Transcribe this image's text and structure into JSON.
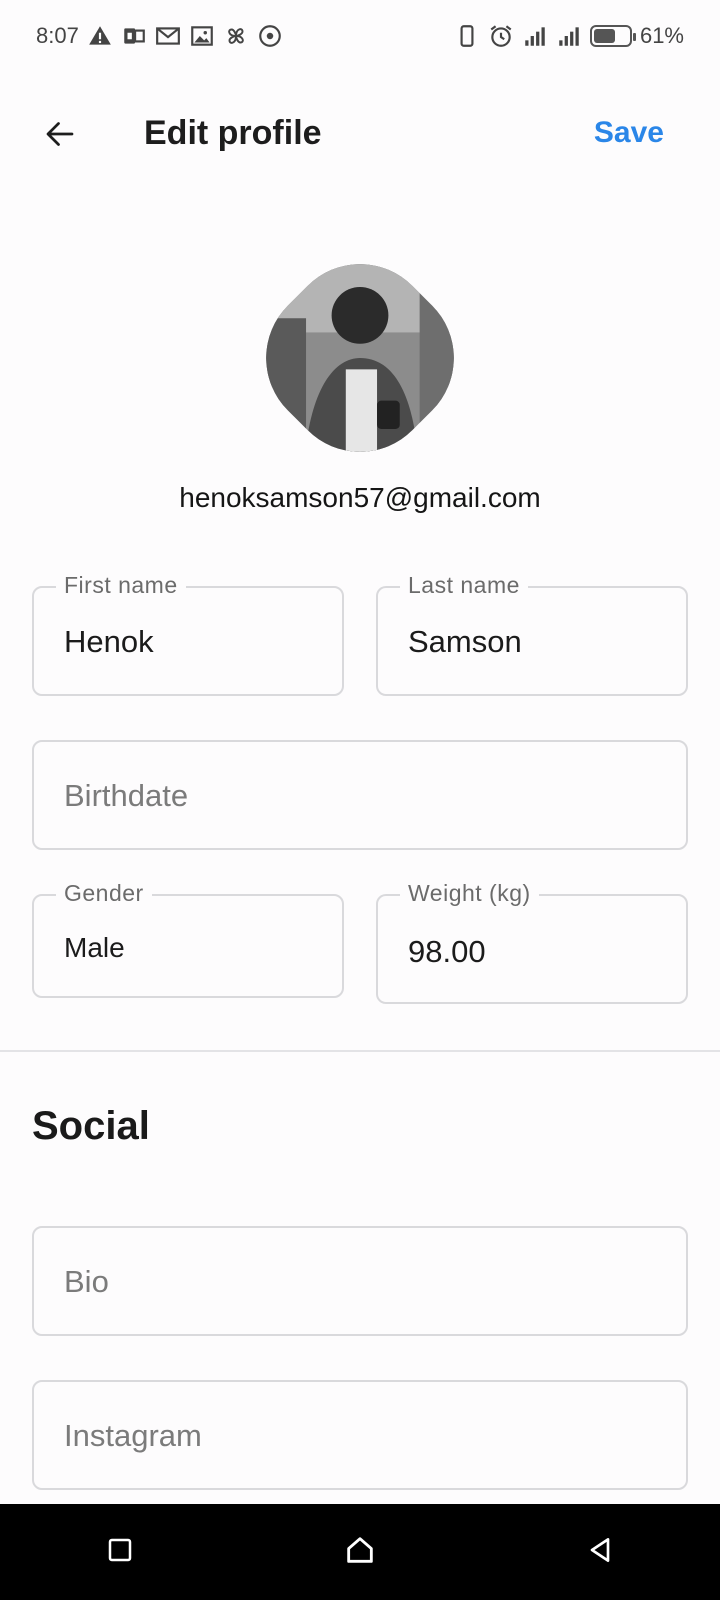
{
  "status_bar": {
    "time": "8:07",
    "battery_percent": "61%",
    "battery_level": 0.61,
    "left_icons": [
      "warning-icon",
      "outlook-icon",
      "gmail-icon",
      "gallery-icon",
      "pinwheel-icon",
      "circle-dot-icon"
    ],
    "right_icons": [
      "phone-outline-icon",
      "alarm-icon",
      "signal-icon",
      "signal-icon",
      "battery-icon"
    ]
  },
  "app_bar": {
    "title": "Edit profile",
    "save_label": "Save",
    "back_icon": "back-arrow-icon",
    "accent_color": "#2a86e8"
  },
  "profile": {
    "email": "henoksamson57@gmail.com"
  },
  "form": {
    "first_name": {
      "label": "First name",
      "value": "Henok"
    },
    "last_name": {
      "label": "Last name",
      "value": "Samson"
    },
    "birthdate": {
      "placeholder": "Birthdate"
    },
    "gender": {
      "label": "Gender",
      "value": "Male"
    },
    "weight": {
      "label": "Weight (kg)",
      "value": "98.00"
    }
  },
  "social": {
    "title": "Social",
    "bio": {
      "placeholder": "Bio"
    },
    "instagram": {
      "placeholder": "Instagram"
    }
  },
  "nav_bar": {
    "icons": [
      "recents-square-icon",
      "home-icon",
      "back-triangle-icon"
    ]
  }
}
